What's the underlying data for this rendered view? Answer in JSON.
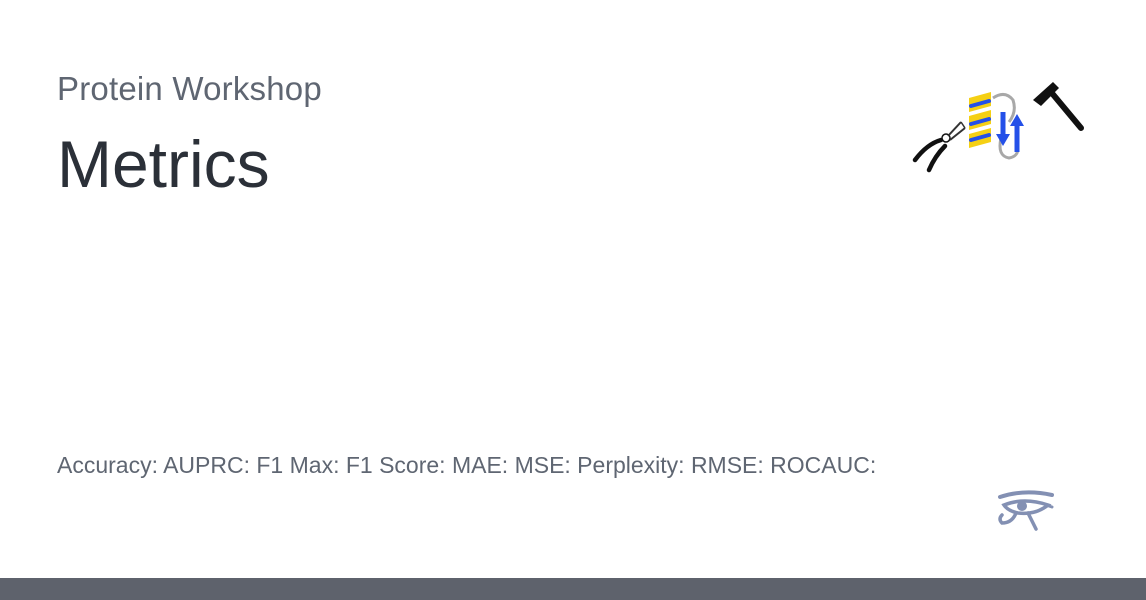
{
  "site": {
    "name": "Protein Workshop"
  },
  "page": {
    "title": "Metrics",
    "description": "Accuracy: AUPRC: F1 Max: F1 Score: MAE: MSE: Perplexity: RMSE: ROCAUC:"
  },
  "icons": {
    "logo": "protein-workshop-logo-icon",
    "pliers": "pliers-icon",
    "hammer": "hammer-icon",
    "eye": "eye-of-horus-icon"
  },
  "colors": {
    "background": "#ffffff",
    "footer": "#5e626c",
    "title": "#2b3038",
    "subtitle": "#5f6672",
    "logo_yellow": "#f5d014",
    "logo_blue": "#2450e8",
    "eye": "#8390b3"
  }
}
